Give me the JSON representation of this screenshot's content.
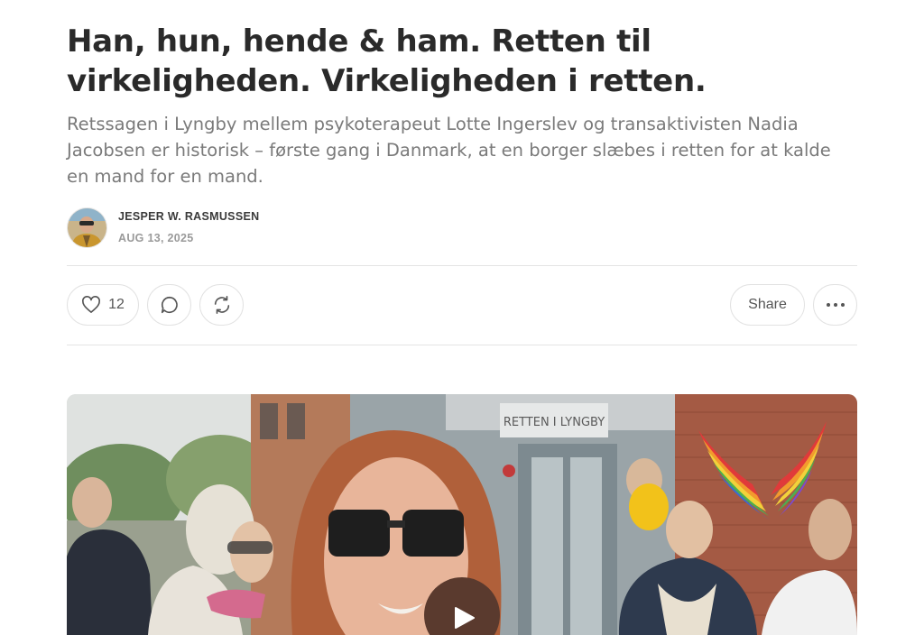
{
  "article": {
    "title": "Han, hun, hende & ham. Retten til virkeligheden. Virkeligheden i retten.",
    "subtitle": "Retssagen i Lyngby mellem psykoterapeut Lotte Ingerslev og transaktivisten Nadia Jacobsen er historisk – første gang i Danmark, at en borger slæbes i retten for at kalde en mand for en mand.",
    "author": "JESPER W. RASMUSSEN",
    "date": "AUG 13, 2025"
  },
  "actions": {
    "like_count": "12",
    "share_label": "Share",
    "icons": [
      "heart-icon",
      "comment-icon",
      "restack-icon",
      "more-icon"
    ]
  },
  "media": {
    "sign_text": "RETTEN I LYNGBY",
    "overlay_icon": "play-icon"
  },
  "colors": {
    "title": "#2a2a2a",
    "subtitle": "#7a7a7a",
    "border": "#e2e2e2",
    "play_button": "#5a3a2e"
  }
}
